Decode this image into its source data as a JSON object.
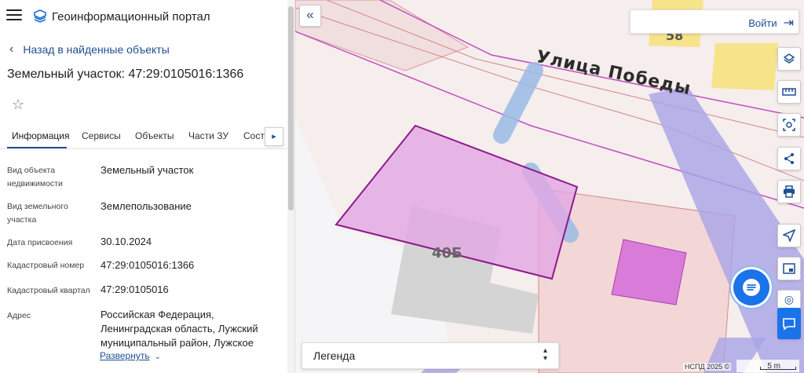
{
  "app": {
    "title": "Геоинформационный портал"
  },
  "panel": {
    "back_label": "Назад в найденные объекты",
    "object_title": "Земельный участок: 47:29:0105016:1366",
    "tabs": [
      {
        "label": "Информация",
        "active": true
      },
      {
        "label": "Сервисы",
        "active": false
      },
      {
        "label": "Объекты",
        "active": false
      },
      {
        "label": "Части ЗУ",
        "active": false
      },
      {
        "label": "Соста",
        "active": false
      }
    ],
    "tab_scroll_icon": "chevron-right-icon",
    "rows": [
      {
        "label_l1": "Вид объекта",
        "label_l2": "недвижимости",
        "value": "Земельный участок"
      },
      {
        "label_l1": "Вид земельного",
        "label_l2": "участка",
        "value": "Землепользование"
      },
      {
        "label_l1": "Дата присвоения",
        "label_l2": "",
        "value": "30.10.2024"
      },
      {
        "label_l1": "Кадастровый номер",
        "label_l2": "",
        "value": "47:29:0105016:1366"
      },
      {
        "label_l1": "Кадастровый квартал",
        "label_l2": "",
        "value": "47:29:0105016"
      },
      {
        "label_l1": "Адрес",
        "label_l2": "",
        "value_lines": [
          "Российская Федерация,",
          "Ленинградская область, Лужский",
          "муниципальный район, Лужское"
        ]
      }
    ],
    "expand_label": "Развернуть"
  },
  "map": {
    "street_label": "Улица Победы",
    "building_label_1": "58",
    "building_label_2": "40Б",
    "login_label": "Войти",
    "legend_label": "Легенда",
    "credit": "НСПД 2025 ©",
    "scale": "5 m",
    "tools": [
      "layers-icon",
      "ruler-icon",
      "select-area-icon",
      "share-icon",
      "print-icon",
      "locate-icon",
      "minimap-icon",
      "pin-icon",
      "help-icon"
    ],
    "colors": {
      "accent": "#1f4f93",
      "parcel_fill": "#e2a6e2",
      "parcel_stroke": "#8b1a8b",
      "chat": "#1a73e8"
    }
  }
}
